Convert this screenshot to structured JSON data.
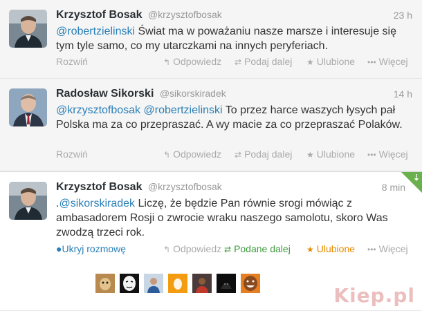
{
  "tweets": [
    {
      "name": "Krzysztof Bosak",
      "handle": "@krzysztofbosak",
      "time": "23 h",
      "mention1": "@robertzielinski",
      "text": " Świat ma w poważaniu nasze marsze i interesuje się tym tyle samo, co my utarczkami na innych peryferiach.",
      "expand": "Rozwiń",
      "reply": "Odpowiedz",
      "retweet": "Podaj dalej",
      "favorite": "Ulubione",
      "more": "Więcej"
    },
    {
      "name": "Radosław Sikorski",
      "handle": "@sikorskiradek",
      "time": "14 h",
      "mention1": "@krzysztofbosak",
      "mention2": "@robertzielinski",
      "text": " To przez harce waszych łysych pał Polska ma za co przepraszać. A wy macie za co przepraszać Polaków.",
      "expand": "Rozwiń",
      "reply": "Odpowiedz",
      "retweet": "Podaj dalej",
      "favorite": "Ulubione",
      "more": "Więcej"
    },
    {
      "name": "Krzysztof Bosak",
      "handle": "@krzysztofbosak",
      "time": "8 min",
      "prefix": ".",
      "mention1": "@sikorskiradek",
      "text": " Liczę, że będzie Pan równie srogi mówiąc z ambasadorem Rosji o zwrocie wraku naszego samolotu, skoro Was zwodzą trzeci rok.",
      "expand": "Ukryj rozmowę",
      "reply": "Odpowiedz",
      "retweet": "Podane dalej",
      "favorite": "Ulubione",
      "more": "Więcej"
    }
  ],
  "watermark": "Kiep.pl",
  "colors": {
    "link": "#2a7fb6",
    "retweeted": "#3c9a3c",
    "favorited": "#e68a00",
    "ribbon": "#6ab04c"
  },
  "icons": {
    "reply": "reply-icon",
    "retweet": "retweet-icon",
    "favorite": "star-icon",
    "more": "more-dots-icon",
    "conversation": "speech-bubble-icon"
  }
}
